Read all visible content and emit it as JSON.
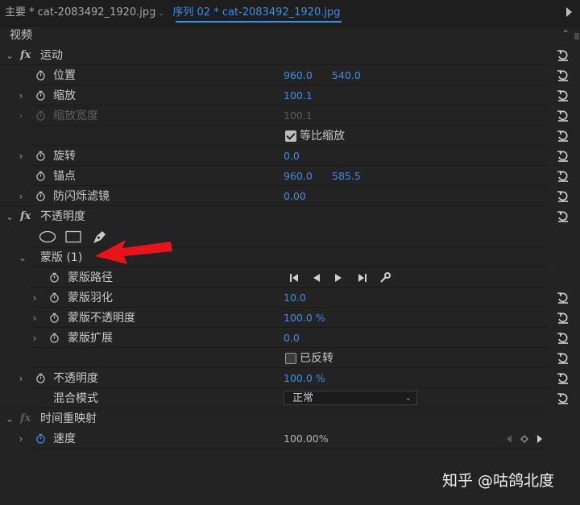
{
  "tabs": {
    "main": "主要 * cat-2083492_1920.jpg",
    "sequence": "序列 02 * cat-2083492_1920.jpg",
    "sequence_chevron": "⌄"
  },
  "section": {
    "video": "视频"
  },
  "motion": {
    "label": "运动",
    "fx": "fx",
    "position": {
      "label": "位置",
      "x": "960.0",
      "y": "540.0"
    },
    "scale": {
      "label": "缩放",
      "value": "100.1"
    },
    "scale_width": {
      "label": "缩放宽度",
      "value": "100.1"
    },
    "uniform_scale": {
      "label": "等比缩放",
      "checked": true
    },
    "rotation": {
      "label": "旋转",
      "value": "0.0"
    },
    "anchor": {
      "label": "锚点",
      "x": "960.0",
      "y": "585.5"
    },
    "antiflicker": {
      "label": "防闪烁滤镜",
      "value": "0.00"
    }
  },
  "opacity": {
    "label": "不透明度",
    "fx": "fx",
    "mask": {
      "label": "蒙版 (1)",
      "path": {
        "label": "蒙版路径"
      },
      "feather": {
        "label": "蒙版羽化",
        "value": "10.0"
      },
      "opacity": {
        "label": "蒙版不透明度",
        "value": "100.0 %"
      },
      "expansion": {
        "label": "蒙版扩展",
        "value": "0.0"
      },
      "inverted": {
        "label": "已反转",
        "checked": false
      }
    },
    "opacity_value": {
      "label": "不透明度",
      "value": "100.0 %"
    },
    "blend_mode": {
      "label": "混合模式",
      "value": "正常"
    }
  },
  "time_remap": {
    "label": "时间重映射",
    "fx": "fx",
    "speed": {
      "label": "速度",
      "value": "100.00%"
    }
  },
  "watermark": "知乎 @咕鸽北度",
  "colors": {
    "accent": "#3f8ee6",
    "arrow": "#e8141c",
    "background": "#232323"
  }
}
